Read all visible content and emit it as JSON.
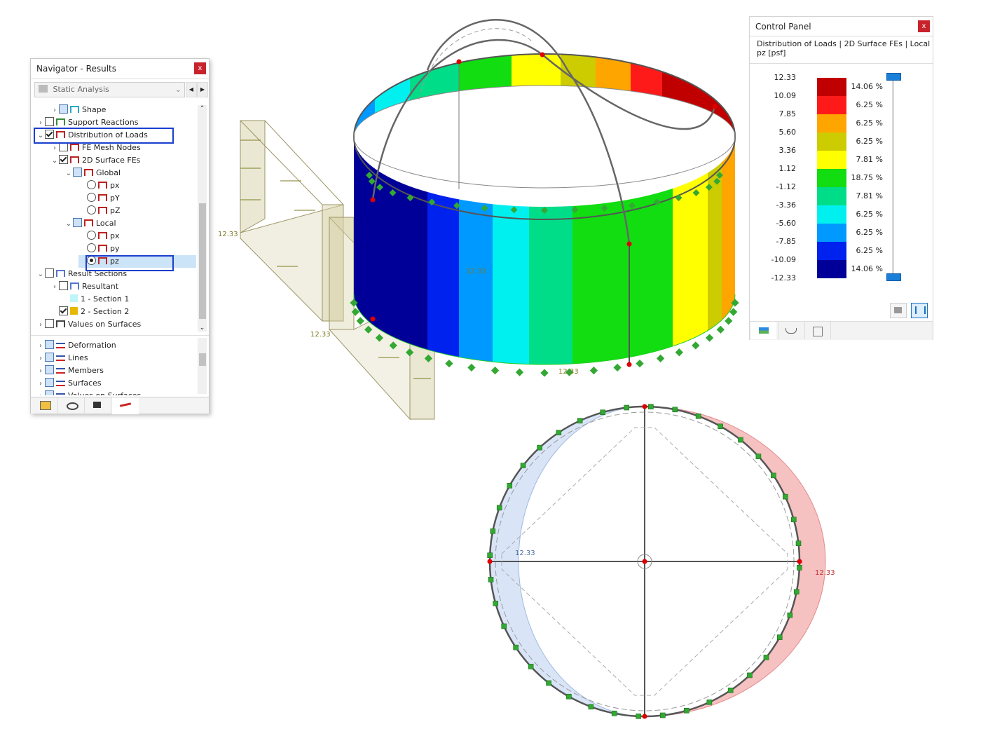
{
  "navigator": {
    "title": "Navigator - Results",
    "close": "x",
    "analysis_select": "Static Analysis",
    "tree": [
      {
        "label": "Shape",
        "indent": 1
      },
      {
        "label": "Support Reactions",
        "indent": 0
      },
      {
        "label": "Distribution of Loads",
        "indent": 0
      },
      {
        "label": "FE Mesh Nodes",
        "indent": 1
      },
      {
        "label": "2D Surface FEs",
        "indent": 1
      },
      {
        "label": "Global",
        "indent": 2
      },
      {
        "label": "px",
        "indent": 3
      },
      {
        "label": "pY",
        "indent": 3
      },
      {
        "label": "pZ",
        "indent": 3
      },
      {
        "label": "Local",
        "indent": 2
      },
      {
        "label": "px",
        "indent": 3
      },
      {
        "label": "py",
        "indent": 3
      },
      {
        "label": "pz",
        "indent": 3
      },
      {
        "label": "Result Sections",
        "indent": 0
      },
      {
        "label": "Resultant",
        "indent": 1
      },
      {
        "label": "1 - Section 1",
        "indent": 1
      },
      {
        "label": "2 - Section 2",
        "indent": 1
      },
      {
        "label": "Values on Surfaces",
        "indent": 0
      }
    ],
    "tree2": [
      {
        "label": "Deformation"
      },
      {
        "label": "Lines"
      },
      {
        "label": "Members"
      },
      {
        "label": "Surfaces"
      },
      {
        "label": "Values on Surfaces"
      }
    ],
    "section1_color": "#bff4f8",
    "section2_color": "#e6b800"
  },
  "control_panel": {
    "title": "Control Panel",
    "close": "x",
    "header_line1": "Distribution of Loads | 2D Surface FEs | Local",
    "header_line2": "pz [psf]",
    "legend_values": [
      "12.33",
      "10.09",
      "7.85",
      "5.60",
      "3.36",
      "1.12",
      "-1.12",
      "-3.36",
      "-5.60",
      "-7.85",
      "-10.09",
      "-12.33"
    ],
    "legend_colors": [
      "#c00000",
      "#ff1a1a",
      "#ffa500",
      "#cccc00",
      "#ffff00",
      "#11dd11",
      "#00dd88",
      "#00f0f0",
      "#0099ff",
      "#0022ee",
      "#000099"
    ],
    "legend_percents": [
      "14.06 %",
      "6.25 %",
      "6.25 %",
      "6.25 %",
      "7.81 %",
      "18.75 %",
      "7.81 %",
      "6.25 %",
      "6.25 %",
      "6.25 %",
      "14.06 %"
    ]
  },
  "model_labels": {
    "load_value_a": "12.33",
    "load_value_b": "12.33",
    "load_value_c": "12.33",
    "load_value_d": "12.33",
    "plan_left": "12.33",
    "plan_right": "12.33"
  }
}
